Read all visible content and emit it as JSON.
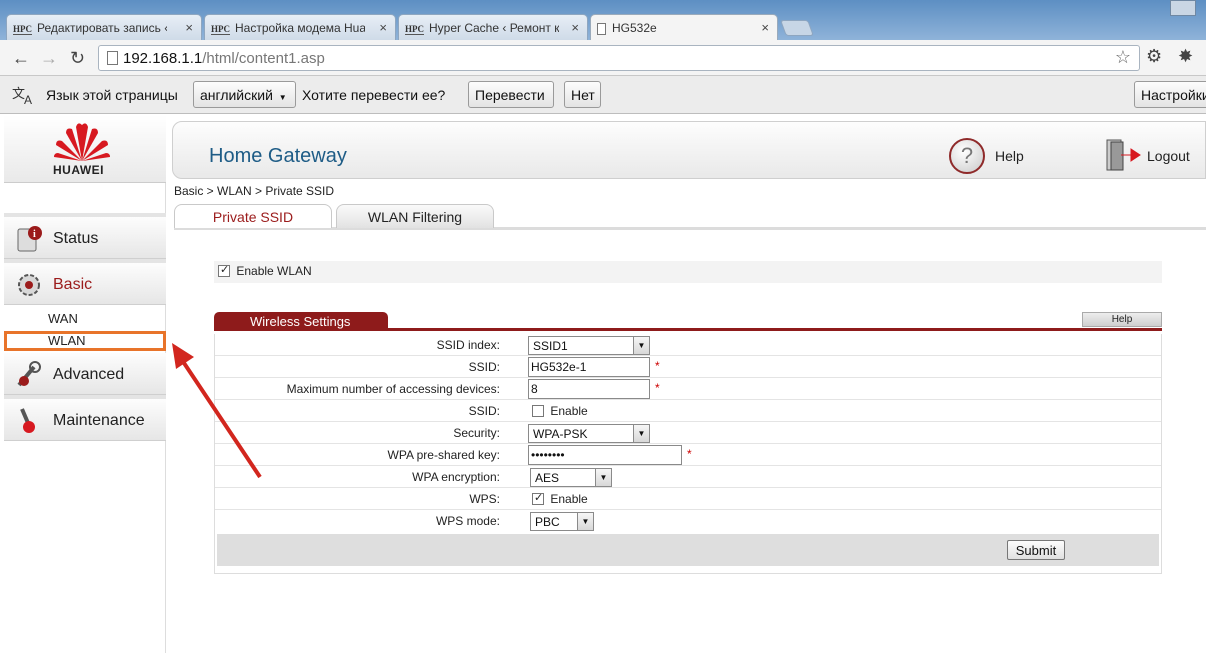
{
  "browser": {
    "tabs": [
      {
        "favicon": "HPC",
        "title": "Редактировать запись ‹ P"
      },
      {
        "favicon": "HPC",
        "title": "Настройка модема Huaw"
      },
      {
        "favicon": "HPC",
        "title": "Hyper Cache ‹ Ремонт ко"
      },
      {
        "favicon": "",
        "title": "HG532e"
      }
    ],
    "url_host": "192.168.1.1",
    "url_path": "/html/content1.asp"
  },
  "translate_bar": {
    "prefix": "Язык этой страницы",
    "language": "английский",
    "question": "Хотите перевести ее?",
    "translate_button": "Перевести",
    "no_button": "Нет",
    "settings_button": "Настройки"
  },
  "router": {
    "brand": "HUAWEI",
    "title": "Home Gateway",
    "help": "Help",
    "logout": "Logout",
    "breadcrumb": "Basic > WLAN > Private SSID",
    "menu": {
      "status": "Status",
      "basic": "Basic",
      "wan": "WAN",
      "wlan": "WLAN",
      "advanced": "Advanced",
      "maintenance": "Maintenance"
    },
    "tabs": {
      "private_ssid": "Private SSID",
      "wlan_filtering": "WLAN Filtering"
    },
    "enable_wlan": "Enable WLAN",
    "section_title": "Wireless Settings",
    "section_help": "Help",
    "fields": {
      "ssid_index_label": "SSID index:",
      "ssid_index_value": "SSID1",
      "ssid_label": "SSID:",
      "ssid_value": "HG532e-1",
      "max_devices_label": "Maximum number of accessing devices:",
      "max_devices_value": "8",
      "ssid_enable_label": "SSID:",
      "enable_text": "Enable",
      "security_label": "Security:",
      "security_value": "WPA-PSK",
      "psk_label": "WPA pre-shared key:",
      "psk_value": "••••••••",
      "encryption_label": "WPA encryption:",
      "encryption_value": "AES",
      "wps_label": "WPS:",
      "wps_mode_label": "WPS mode:",
      "wps_mode_value": "PBC",
      "required_mark": "*"
    },
    "submit": "Submit",
    "colors": {
      "accent": "#8e1b1b",
      "title_blue": "#1e5c86",
      "highlight": "#e8742a"
    }
  }
}
